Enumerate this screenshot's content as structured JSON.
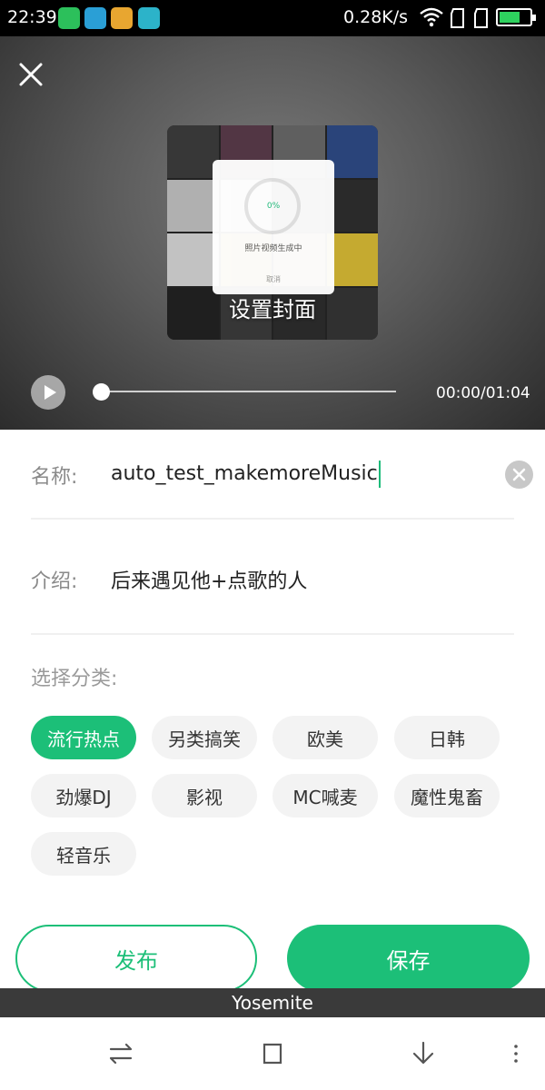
{
  "status_bar": {
    "time": "22:39",
    "network_speed": "0.28K/s",
    "app_icons": [
      "wechat-icon",
      "browser-icon",
      "gallery-icon",
      "usb-icon"
    ],
    "app_icon_colors": [
      "#2cc05b",
      "#2a9fd6",
      "#e8a630",
      "#2cb3c9"
    ],
    "battery_level": 0.7
  },
  "player": {
    "cover_label": "设置封面",
    "progress_percent": "0%",
    "progress_text": "照片视频生成中",
    "progress_cancel": "取消",
    "time": "00:00/01:04",
    "seek_position": 0
  },
  "form": {
    "name_label": "名称:",
    "name_value": "auto_test_makemoreMusic",
    "intro_label": "介绍:",
    "intro_value": "后来遇见他+点歌的人",
    "category_label": "选择分类:"
  },
  "categories": [
    {
      "label": "流行热点",
      "selected": true
    },
    {
      "label": "另类搞笑",
      "selected": false
    },
    {
      "label": "欧美",
      "selected": false
    },
    {
      "label": "日韩",
      "selected": false
    },
    {
      "label": "劲爆DJ",
      "selected": false
    },
    {
      "label": "影视",
      "selected": false
    },
    {
      "label": "MC喊麦",
      "selected": false
    },
    {
      "label": "魔性鬼畜",
      "selected": false
    },
    {
      "label": "轻音乐",
      "selected": false
    }
  ],
  "actions": {
    "publish_label": "发布",
    "save_label": "保存"
  },
  "debug_label": "Yosemite",
  "colors": {
    "accent": "#1cbf78"
  }
}
